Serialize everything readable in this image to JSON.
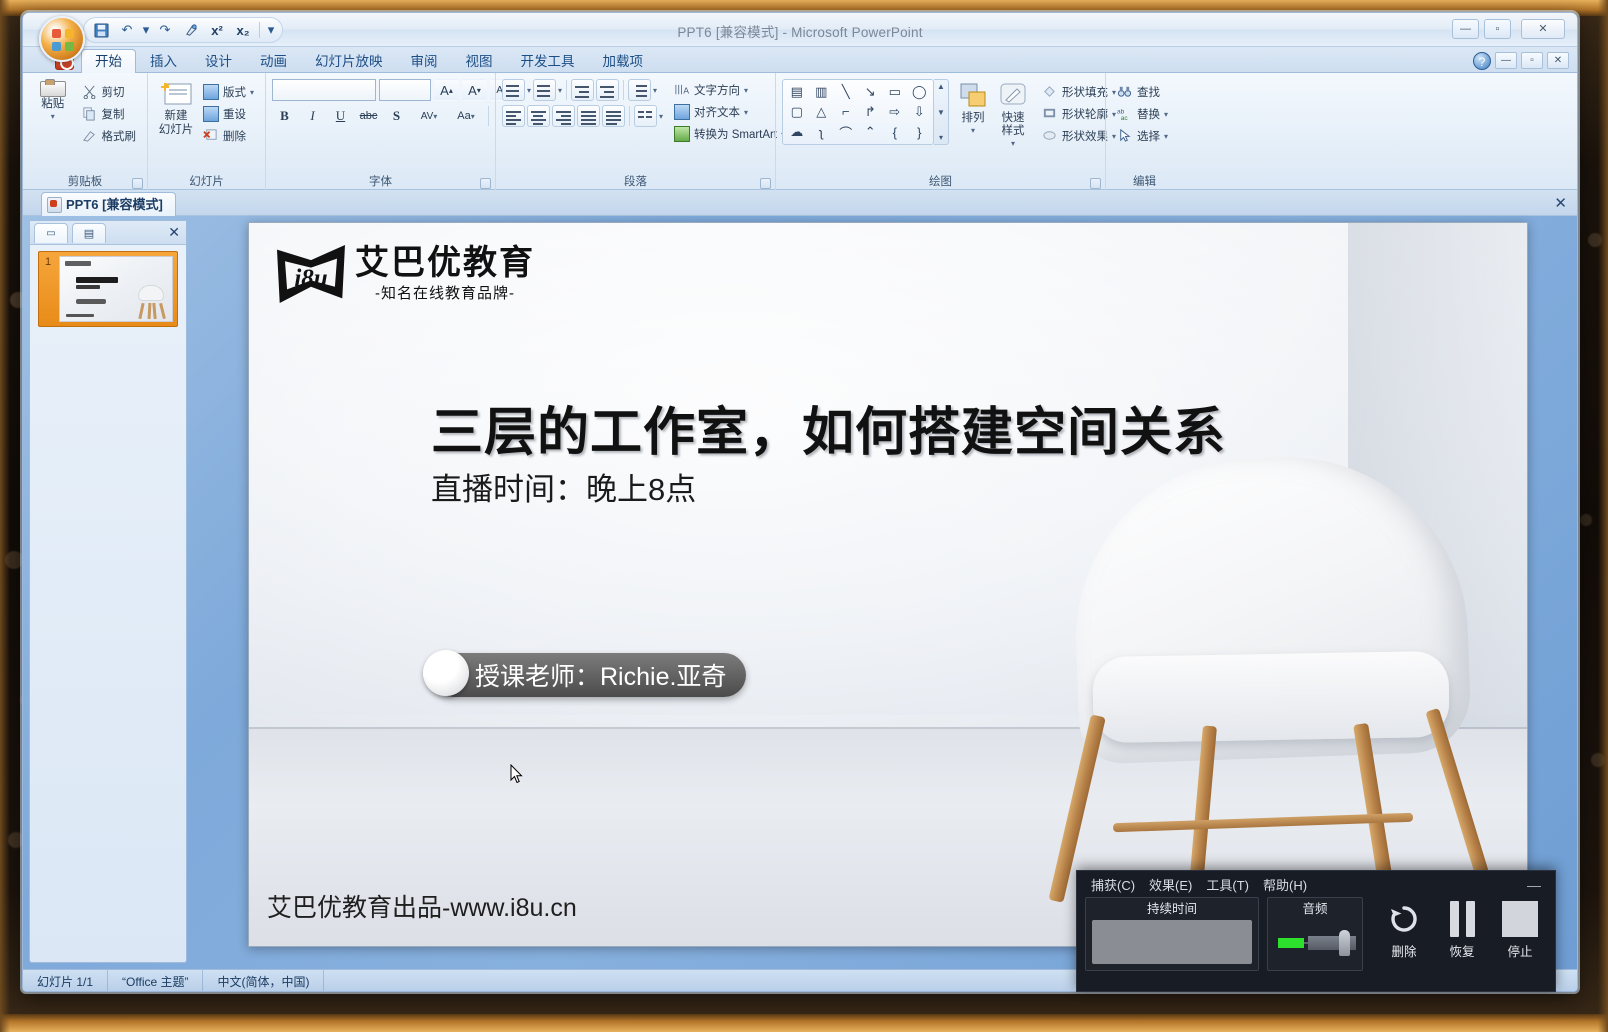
{
  "window": {
    "title": "PPT6 [兼容模式] - Microsoft PowerPoint",
    "minimize": "—",
    "maximize": "▫",
    "close": "✕"
  },
  "qat": {
    "save": "save-icon",
    "undo": "↶",
    "undo_caret": "▾",
    "redo": "↷",
    "format": "format-icon",
    "superscript": "x²",
    "subscript": "x₂",
    "more": "▾"
  },
  "ribbon": {
    "tabs": [
      {
        "label": "开始",
        "active": true
      },
      {
        "label": "插入",
        "active": false
      },
      {
        "label": "设计",
        "active": false
      },
      {
        "label": "动画",
        "active": false
      },
      {
        "label": "幻灯片放映",
        "active": false
      },
      {
        "label": "审阅",
        "active": false
      },
      {
        "label": "视图",
        "active": false
      },
      {
        "label": "开发工具",
        "active": false
      },
      {
        "label": "加载项",
        "active": false
      }
    ],
    "help": "?",
    "min": "—",
    "max": "▫",
    "close": "✕",
    "groups": {
      "clipboard": {
        "title": "剪贴板",
        "paste": "粘贴",
        "paste_caret": "▾",
        "cut": "剪切",
        "copy": "复制",
        "format_painter": "格式刷"
      },
      "slides": {
        "title": "幻灯片",
        "new_slide_line1": "新建",
        "new_slide_line2": "幻灯片",
        "new_slide_caret": "▾",
        "layout": "版式",
        "layout_caret": "▾",
        "reset": "重设",
        "delete": "删除"
      },
      "font": {
        "title": "字体",
        "font_name_value": "",
        "font_size_value": "",
        "grow": "A",
        "shrink": "A",
        "clear": "Aa",
        "bold": "B",
        "italic": "I",
        "underline": "U",
        "strike": "abc",
        "shadow": "S",
        "spacing": "AV",
        "case": "Aa",
        "color": "A"
      },
      "paragraph": {
        "title": "段落",
        "text_direction": "文字方向",
        "align_text": "对齐文本",
        "smartart": "转换为 SmartArt"
      },
      "drawing": {
        "title": "绘图",
        "arrange": "排列",
        "arrange_caret": "▾",
        "quick_styles": "快速样式",
        "quick_styles_caret": "▾",
        "shape_fill": "形状填充",
        "shape_outline": "形状轮廓",
        "shape_effects": "形状效果",
        "shapes": [
          "▤",
          "▥",
          "╲",
          "↘",
          "▭",
          "◯",
          "▢",
          "△",
          "⌐",
          "↱",
          "⇨",
          "⇩",
          "☁",
          "ʅ",
          "⌒",
          "⌃",
          "{",
          "}"
        ],
        "scroll_up": "▲",
        "scroll_down": "▼",
        "scroll_more": "▾"
      },
      "editing": {
        "title": "编辑",
        "find": "查找",
        "replace": "替换",
        "select": "选择"
      }
    }
  },
  "doctab": {
    "label": "PPT6 [兼容模式]",
    "close": "✕"
  },
  "outline_pane": {
    "tab_minimize": "▭",
    "tab_outline": "▤",
    "close": "✕",
    "slide_number": "1"
  },
  "slide": {
    "logo_main": "艾巴优教育",
    "logo_sub": "-知名在线教育品牌-",
    "logo_mark": "i8u",
    "title": "三层的工作室，如何搭建空间关系",
    "subtitle": "直播时间：晚上8点",
    "teacher_badge": "授课老师：Richie.亚奇",
    "footer": "艾巴优教育出品-www.i8u.cn"
  },
  "statusbar": {
    "slide_count": "幻灯片 1/1",
    "theme": "“Office 主题”",
    "language": "中文(简体，中国)"
  },
  "recorder": {
    "menus": [
      "捕获(C)",
      "效果(E)",
      "工具(T)",
      "帮助(H)"
    ],
    "minimize": "—",
    "duration_label": "持续时间",
    "audio_label": "音频",
    "buttons": [
      {
        "label": "删除",
        "icon": "undo-circle-icon"
      },
      {
        "label": "恢复",
        "icon": "pause-icon"
      },
      {
        "label": "停止",
        "icon": "stop-icon"
      }
    ]
  },
  "colors": {
    "accent": "#1d4f87",
    "slide_selected": "#f6a63c",
    "recorder_bg": "#181c24",
    "audio_level": "#2ee02e"
  }
}
